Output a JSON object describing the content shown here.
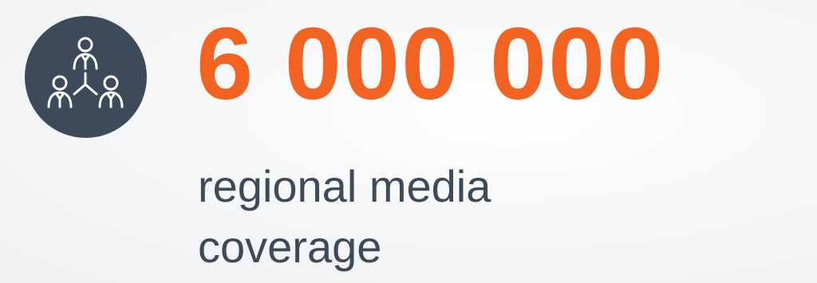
{
  "stat": {
    "value": "6 000 000",
    "caption_lines": [
      "regional media",
      "coverage"
    ]
  },
  "icon": {
    "name": "people-network-icon"
  },
  "colors": {
    "accent": "#f26322",
    "badge": "#3d4a5a",
    "text": "#3d4a5a"
  }
}
